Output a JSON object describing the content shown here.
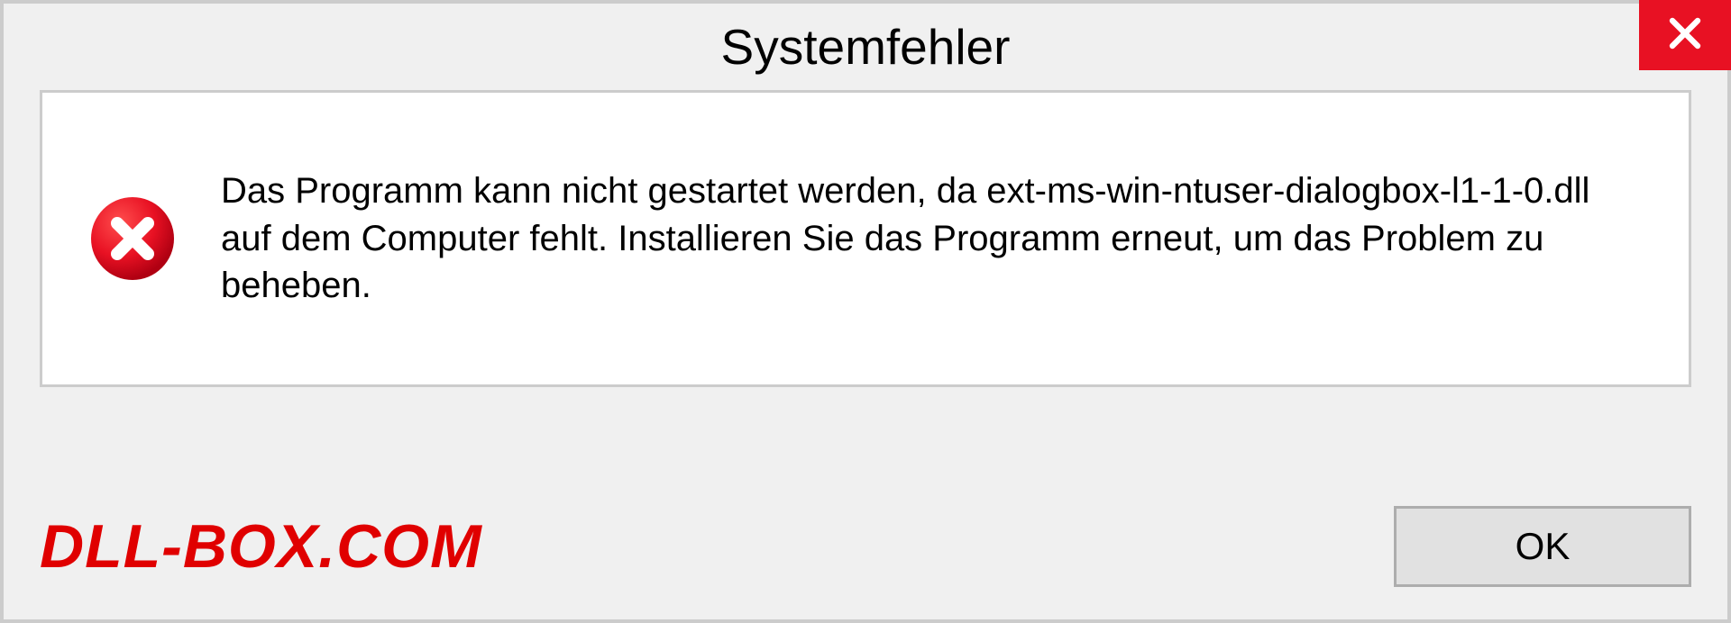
{
  "dialog": {
    "title": "Systemfehler",
    "message": "Das Programm kann nicht gestartet werden, da ext-ms-win-ntuser-dialogbox-l1-1-0.dll auf dem Computer fehlt. Installieren Sie das Programm erneut, um das Problem zu beheben.",
    "ok_label": "OK"
  },
  "watermark": "DLL-BOX.COM"
}
